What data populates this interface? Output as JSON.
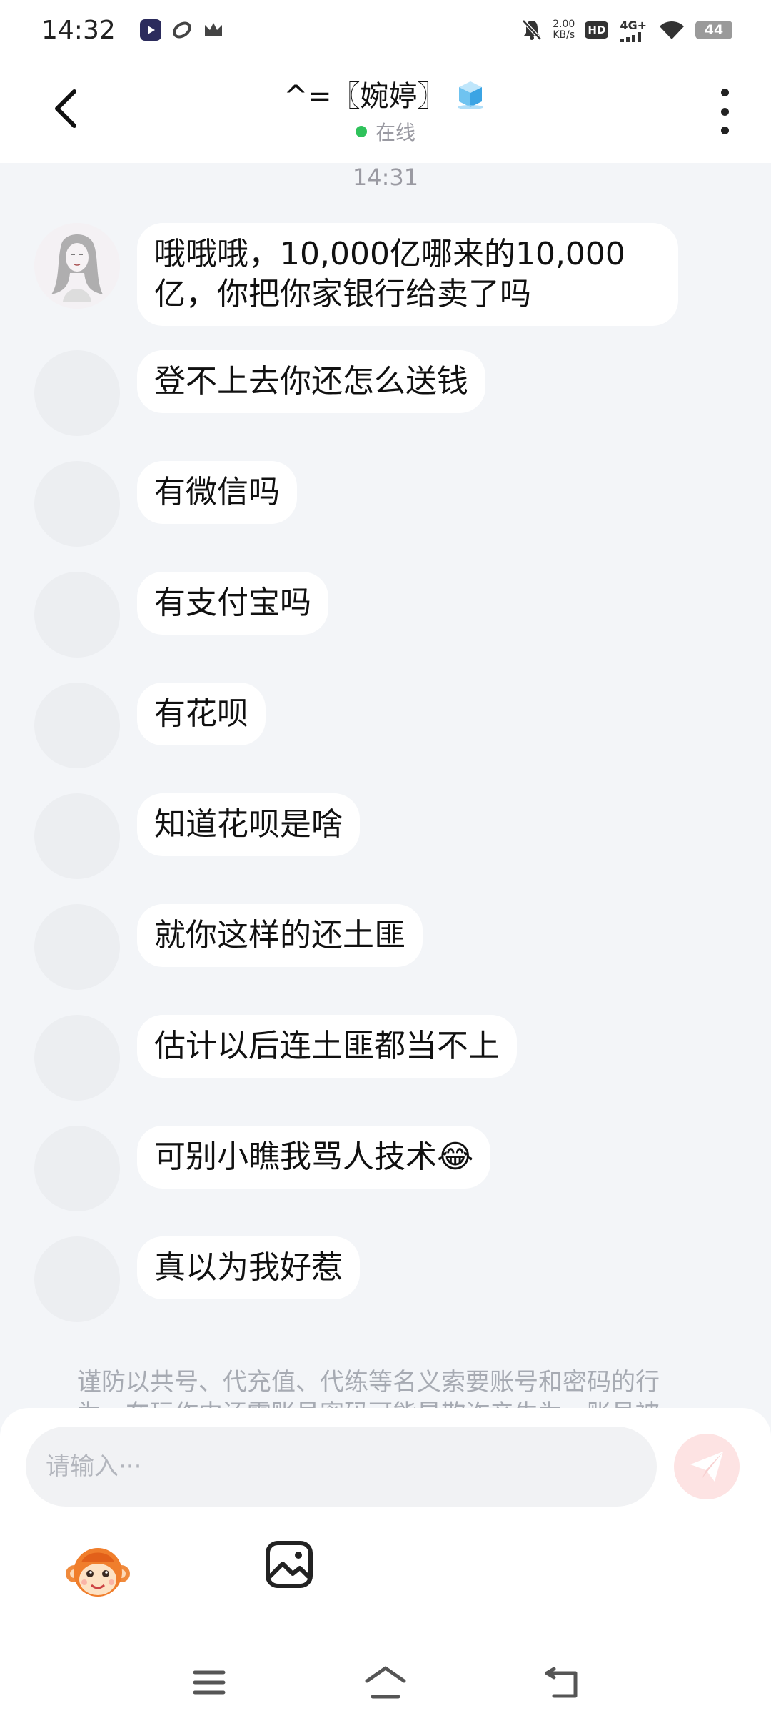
{
  "status_bar": {
    "time": "14:32",
    "net_speed_value": "2.00",
    "net_speed_unit": "KB/s",
    "hd_label": "HD",
    "signal_label": "4G+",
    "battery": "44"
  },
  "header": {
    "contact_name": "^=〖婉婷〗",
    "online_status": "在线"
  },
  "chat": {
    "timestamp": "14:31",
    "messages": [
      {
        "text": "哦哦哦，10,000亿哪来的10,000亿，你把你家银行给卖了吗"
      },
      {
        "text": "登不上去你还怎么送钱"
      },
      {
        "text": "有微信吗"
      },
      {
        "text": "有支付宝吗"
      },
      {
        "text": "有花呗"
      },
      {
        "text": "知道花呗是啥"
      },
      {
        "text": "就你这样的还土匪"
      },
      {
        "text": "估计以后连土匪都当不上"
      },
      {
        "text": "可别小瞧我骂人技术😂"
      },
      {
        "text": "真以为我好惹"
      }
    ],
    "notice": "谨防以共号、代充值、代练等名义索要账号和密码的行为，在玩作中还需账号密码可能是欺诈产生为，账号被"
  },
  "composer": {
    "placeholder": "请输入···"
  },
  "colors": {
    "background": "#f3f5f8",
    "bubble": "#ffffff",
    "online": "#2fc25b",
    "send_button": "#fde3e3"
  }
}
